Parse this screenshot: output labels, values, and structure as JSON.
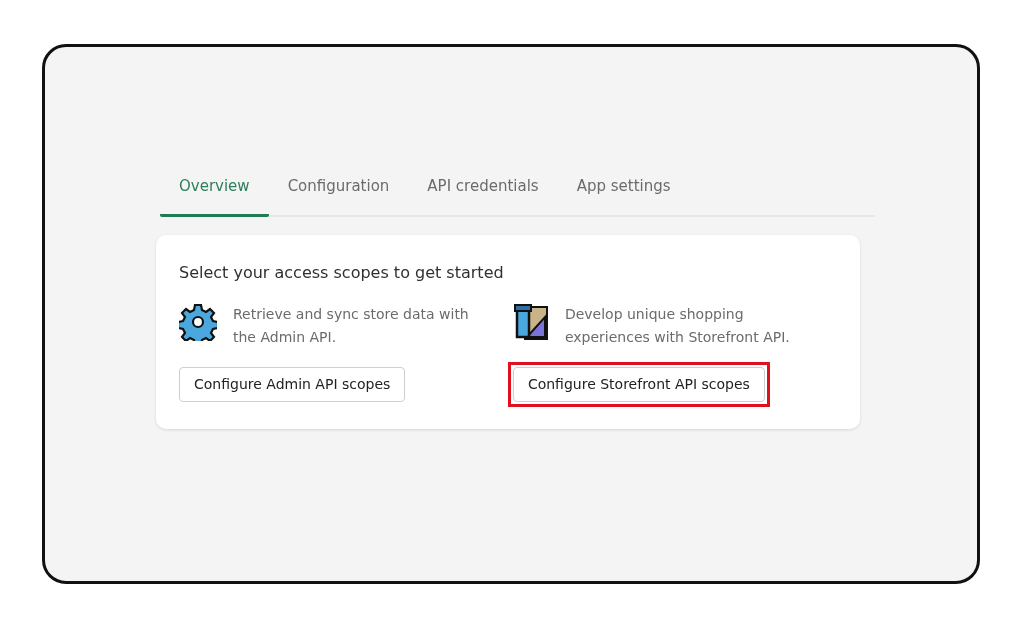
{
  "tabs": [
    {
      "label": "Overview",
      "selected": true
    },
    {
      "label": "Configuration",
      "selected": false
    },
    {
      "label": "API credentials",
      "selected": false
    },
    {
      "label": "App settings",
      "selected": false
    }
  ],
  "card": {
    "title": "Select your access scopes to get started",
    "options": [
      {
        "kind": "admin",
        "description": "Retrieve and sync store data with the Admin API.",
        "button": "Configure Admin API scopes",
        "highlighted": false
      },
      {
        "kind": "storefront",
        "description": "Develop unique shopping experiences with Storefront API.",
        "button": "Configure Storefront API scopes",
        "highlighted": true
      }
    ]
  }
}
